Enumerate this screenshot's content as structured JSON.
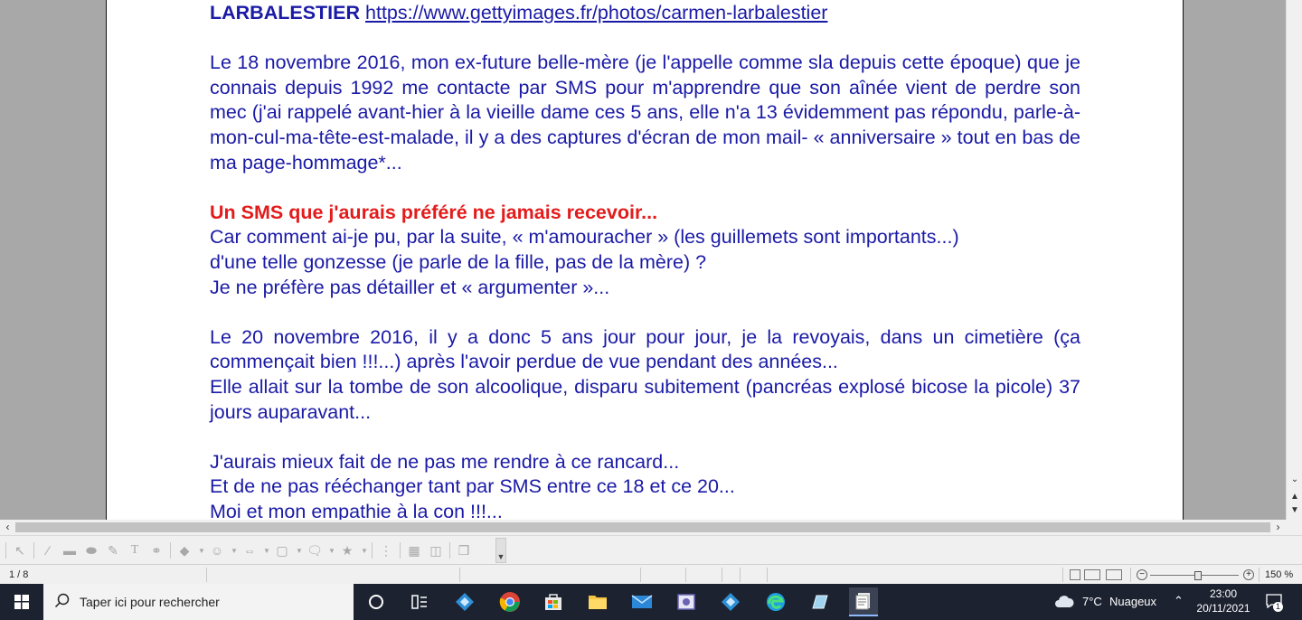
{
  "document": {
    "heading_bold": "LARBALESTIER",
    "heading_link": "https://www.gettyimages.fr/photos/carmen-larbalestier",
    "para1": "Le 18 novembre 2016, mon ex-future belle-mère (je l'appelle comme sla depuis cette époque) que je connais depuis 1992 me contacte par SMS pour m'apprendre que son aînée vient de perdre son mec (j'ai rappelé avant-hier à la vieille dame ces 5 ans, elle n'a 13 évidemment pas répondu, parle-à-mon-cul-ma-tête-est-malade, il y a des captures d'écran de mon mail- « anniversaire » tout en bas de ma page-hommage*...",
    "red_heading": "Un SMS que j'aurais préféré ne jamais recevoir...",
    "line_a": "Car comment ai-je pu, par la suite,  « m'amouracher » (les guillemets sont importants...)",
    "line_b": "d'une telle gonzesse  (je parle de la fille, pas de la mère) ?",
    "line_c": "Je ne préfère pas détailler et « argumenter »...",
    "para2a": "Le 20 novembre 2016, il y a donc 5 ans jour pour jour, je la revoyais, dans un cimetière (ça commençait bien !!!...) après l'avoir perdue de vue pendant des années...",
    "para2b": "Elle allait sur la tombe de son alcoolique, disparu subitement (pancréas explosé bicose la picole) 37 jours auparavant...",
    "line_d": "J'aurais mieux fait de ne pas me rendre à ce rancard...",
    "line_e": "Et de ne pas rééchanger tant par SMS entre ce 18 et ce 20...",
    "line_f": "Moi et mon empathie à la con !!!..."
  },
  "statusbar": {
    "page": "1 / 8",
    "zoom": "150 %"
  },
  "taskbar": {
    "search_placeholder": "Taper ici pour rechercher",
    "weather_temp": "7°C",
    "weather_text": "Nuageux",
    "time": "23:00",
    "date": "20/11/2021",
    "notification_count": "1"
  },
  "colors": {
    "text_blue": "#1a1aa6",
    "heading_red": "#e31b1b",
    "taskbar_bg": "#1c2230"
  }
}
